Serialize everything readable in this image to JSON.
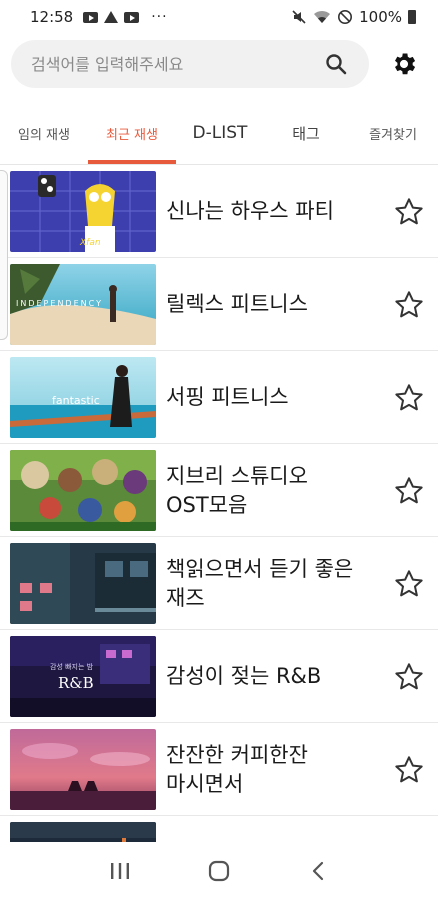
{
  "status_bar": {
    "time": "12:58",
    "battery": "100%",
    "overflow": "···"
  },
  "search": {
    "placeholder": "검색어를 입력해주세요",
    "value": ""
  },
  "tabs": [
    {
      "label": "임의 재생",
      "active": false
    },
    {
      "label": "최근 재생",
      "active": true
    },
    {
      "label": "D-LIST",
      "active": false
    },
    {
      "label": "태그",
      "active": false
    },
    {
      "label": "즐겨찾기",
      "active": false
    }
  ],
  "playlists": [
    {
      "line1": "신나는 하우스 파티",
      "line2": "",
      "favorite": false
    },
    {
      "line1": "릴렉스 피트니스",
      "line2": "",
      "favorite": false
    },
    {
      "line1": "서핑 피트니스",
      "line2": "",
      "favorite": false
    },
    {
      "line1": "지브리 스튜디오",
      "line2": "OST모음",
      "favorite": false
    },
    {
      "line1": "책읽으면서 듣기 좋은",
      "line2": "재즈",
      "favorite": false
    },
    {
      "line1": "감성이 젖는 R&B",
      "line2": "",
      "favorite": false
    },
    {
      "line1": "잔잔한 커피한잔",
      "line2": "마시면서",
      "favorite": false
    }
  ],
  "thumb_text": {
    "independency": "INDEPENDENCY",
    "fantastic": "fantastic",
    "rnb_small": "감성 빠지는 밤",
    "rnb": "R&B"
  },
  "colors": {
    "accent": "#e85a3c",
    "text": "#1a1a1a"
  }
}
